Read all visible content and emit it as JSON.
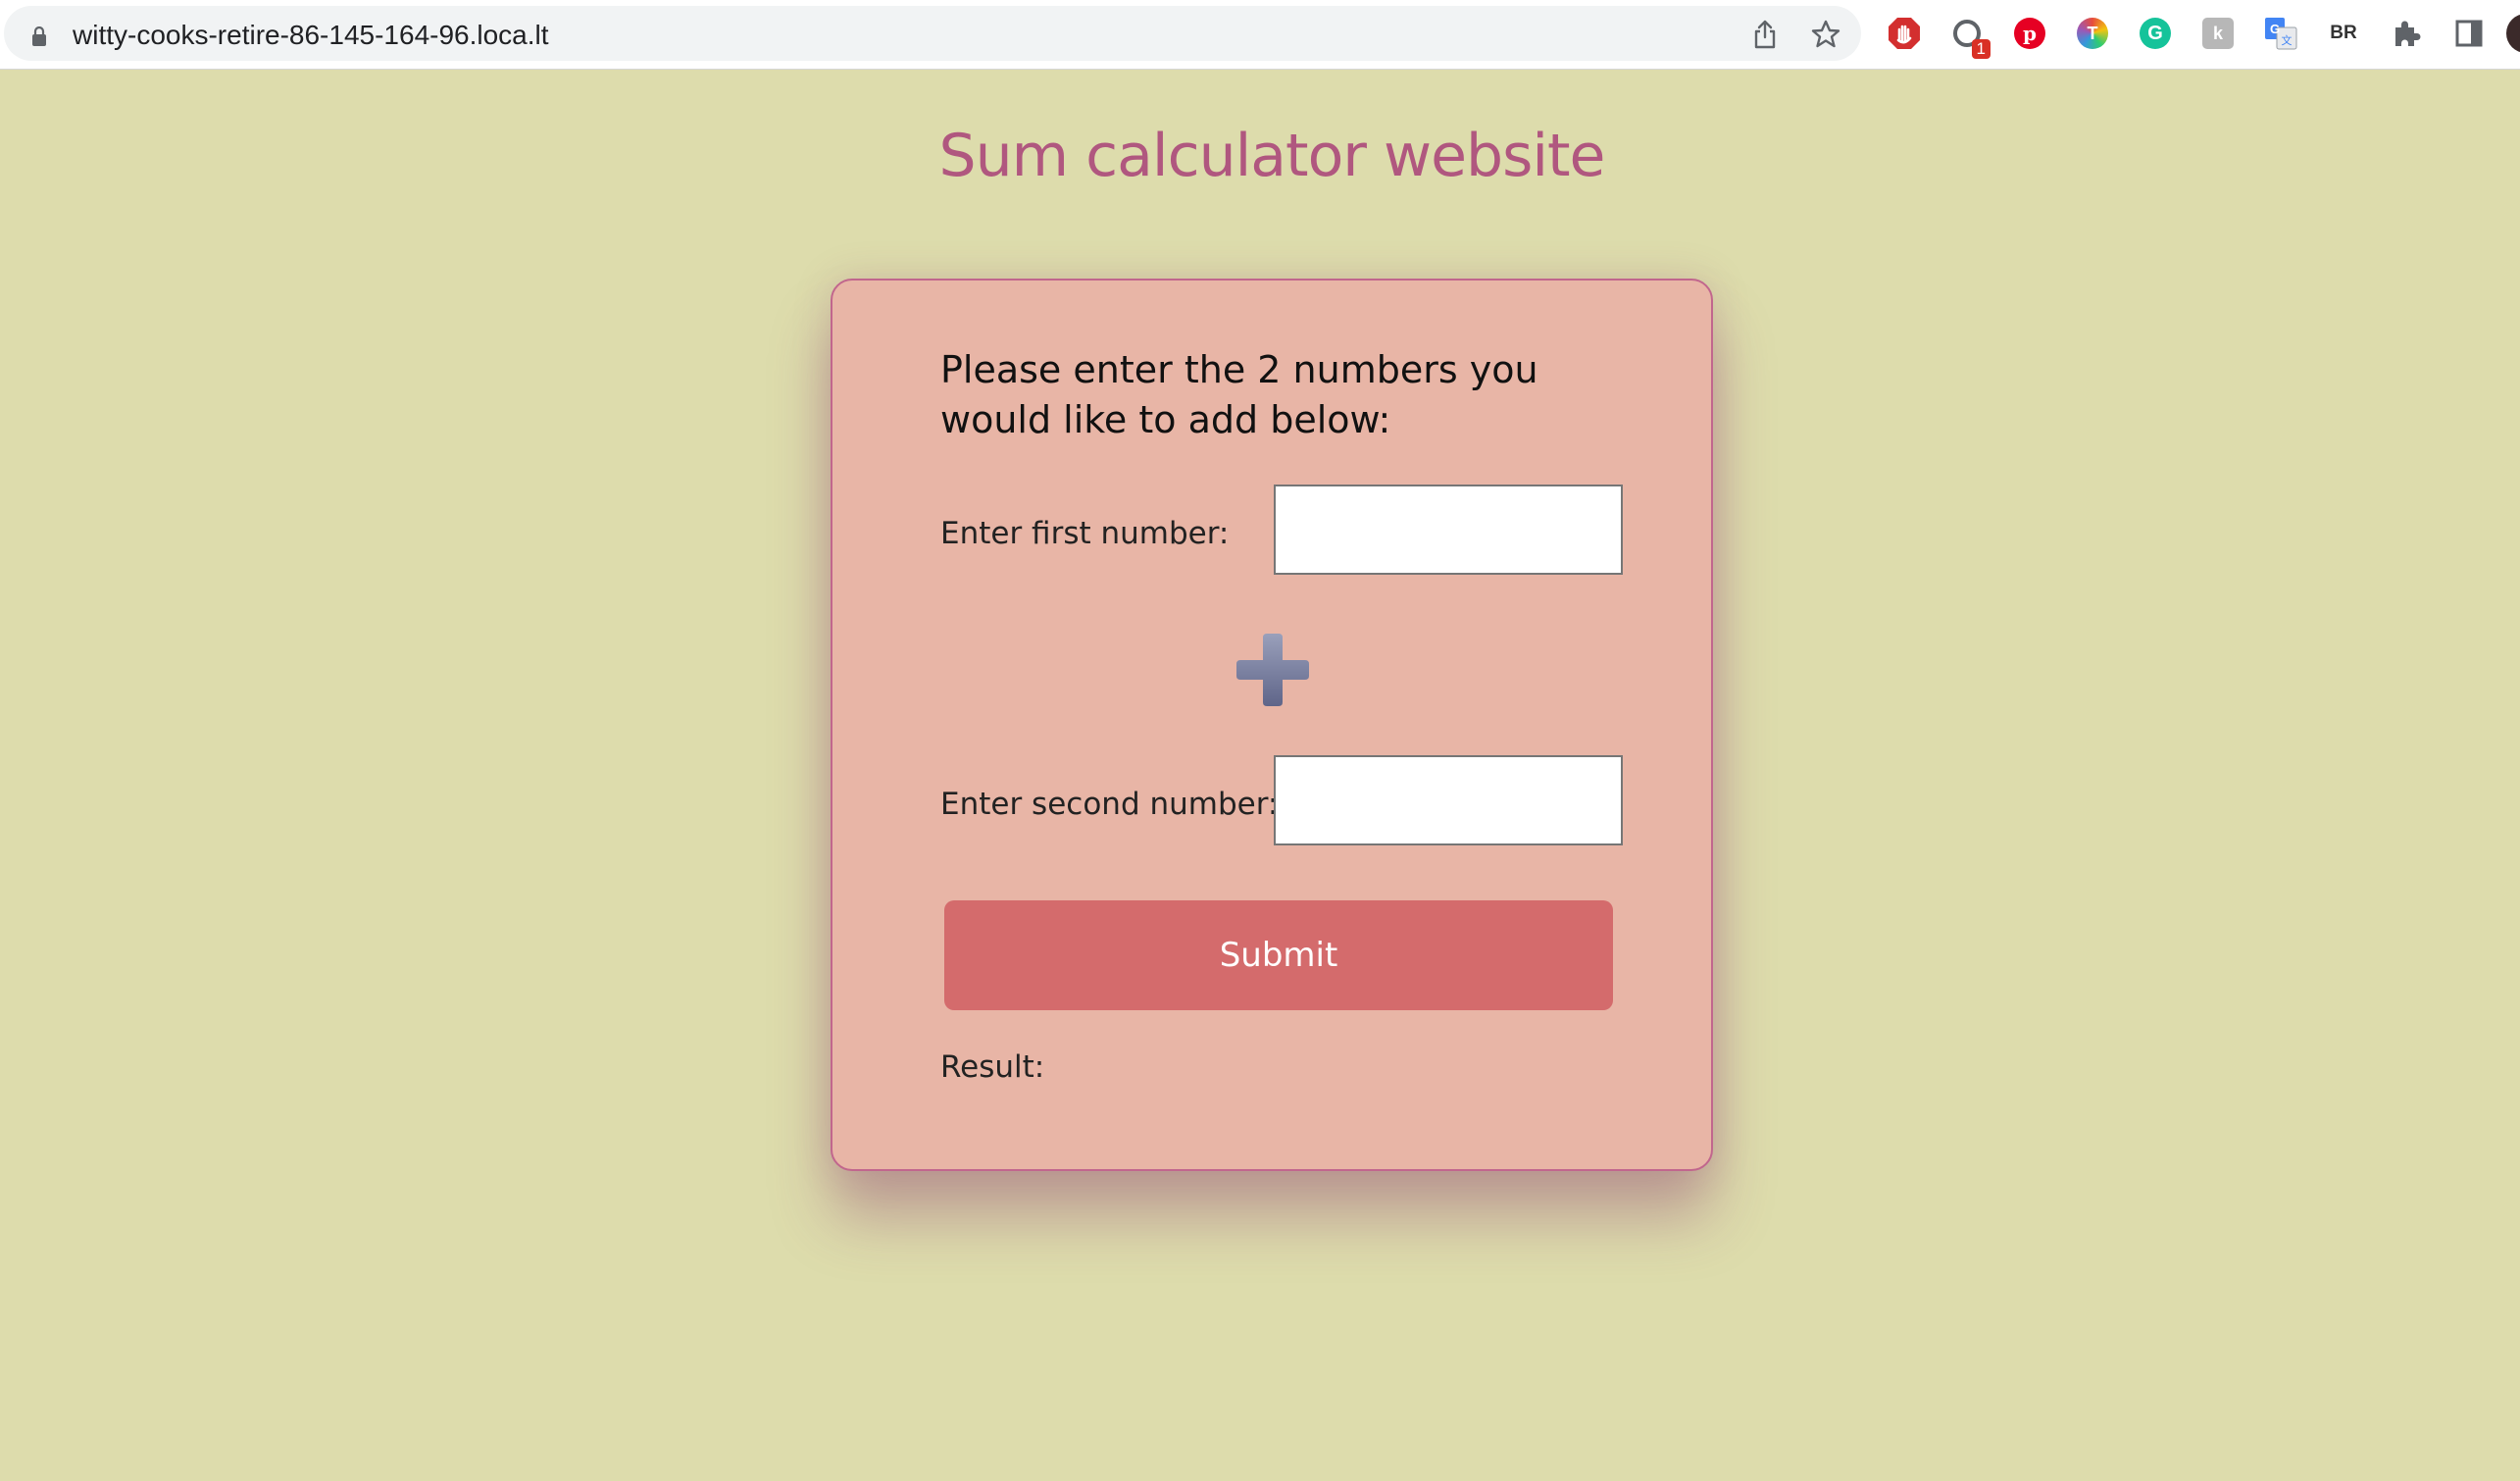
{
  "browser": {
    "url": "witty-cooks-retire-86-145-164-96.loca.lt",
    "extensions": [
      {
        "icon": "adblock-icon",
        "color": "#d32f2f"
      },
      {
        "icon": "extension-badge-icon",
        "color": "#5f6368",
        "badge": "1"
      },
      {
        "icon": "pinterest-icon",
        "color": "#e60023"
      },
      {
        "icon": "color-t-icon",
        "color": "#8e44ad",
        "letter": "T"
      },
      {
        "icon": "grammarly-icon",
        "color": "#15c39a",
        "letter": "G"
      },
      {
        "icon": "extension-k-icon",
        "color": "#9e9e9e"
      },
      {
        "icon": "google-translate-icon",
        "color": "#4285f4"
      },
      {
        "icon": "br-icon",
        "letter": "BR"
      },
      {
        "icon": "puzzle-icon"
      },
      {
        "icon": "side-panel-icon"
      }
    ]
  },
  "page": {
    "title": "Sum calculator website",
    "instructions": "Please enter the 2 numbers you would like to add below:",
    "first_label": "Enter first number:",
    "first_value": "",
    "second_label": "Enter second number:",
    "second_value": "",
    "submit_label": "Submit",
    "result_label": "Result:",
    "result_value": ""
  },
  "colors": {
    "background": "#dddcac",
    "title": "#b0577f",
    "card": "#e8b5a6",
    "card_border": "#c1668d",
    "button": "#d46b6c",
    "plus": "#7d83a4"
  }
}
